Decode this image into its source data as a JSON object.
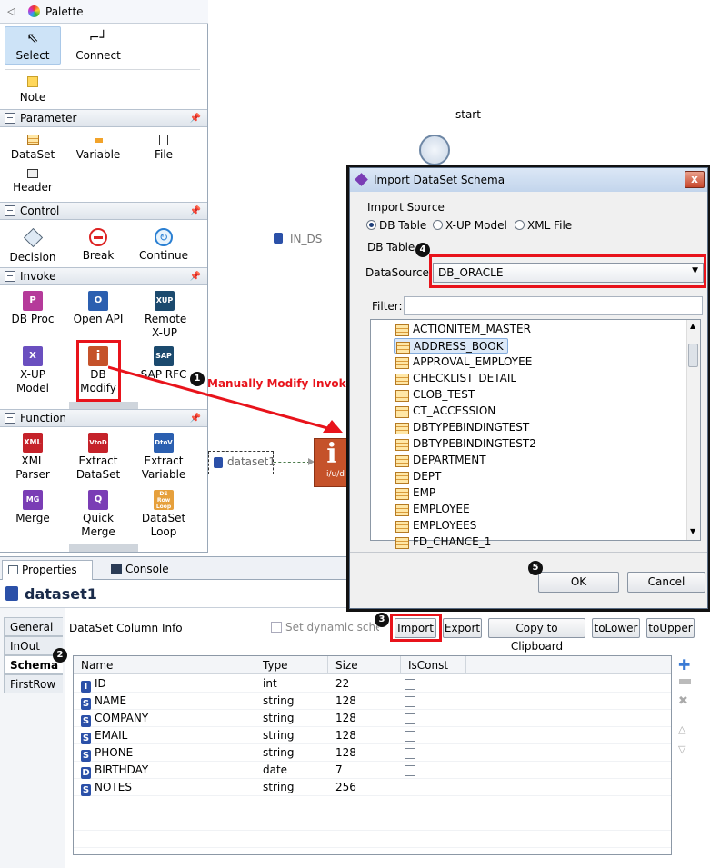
{
  "palette": {
    "title": "Palette",
    "tools": {
      "select": "Select",
      "connect": "Connect",
      "note": "Note"
    },
    "sections": [
      {
        "name": "Parameter",
        "items": [
          "DataSet",
          "Variable",
          "File",
          "Header"
        ]
      },
      {
        "name": "Control",
        "items": [
          "Decision",
          "Break",
          "Continue"
        ]
      },
      {
        "name": "Invoke",
        "items": [
          "DB Proc",
          "Open API",
          "Remote X-UP",
          "X-UP Model",
          "DB Modify",
          "SAP RFC"
        ]
      },
      {
        "name": "Function",
        "items": [
          "XML Parser",
          "Extract DataSet",
          "Extract Variable",
          "Merge",
          "Quick Merge",
          "DataSet Loop"
        ]
      }
    ],
    "icon_text": {
      "dbproc": "P",
      "openapi": "O",
      "xup": "XUP",
      "xupmodel": "X",
      "dbmodify": "i",
      "sap": "SAP",
      "xml": "XML",
      "vtod": "VtoD",
      "dtov": "DtoV",
      "mg": "MG",
      "q": "Q",
      "loop": "DS Row Loop"
    }
  },
  "canvas": {
    "start_label": "start",
    "in_ds_label": "IN_DS",
    "dataset_node": "dataset1",
    "modify_node_label": "i/u/d",
    "annotation": "Manually Modify Invoke"
  },
  "dialog": {
    "title": "Import DataSet Schema",
    "import_source_label": "Import Source",
    "radios": [
      "DB Table",
      "X-UP Model",
      "XML File"
    ],
    "db_table_label": "DB Table",
    "datasource_label": "DataSource:",
    "datasource_value": "DB_ORACLE",
    "filter_label": "Filter:",
    "tables": [
      "ACTIONITEM_MASTER",
      "ADDRESS_BOOK",
      "APPROVAL_EMPLOYEE",
      "CHECKLIST_DETAIL",
      "CLOB_TEST",
      "CT_ACCESSION",
      "DBTYPEBINDINGTEST",
      "DBTYPEBINDINGTEST2",
      "DEPARTMENT",
      "DEPT",
      "EMP",
      "EMPLOYEE",
      "EMPLOYEES",
      "FD_CHANCE_1"
    ],
    "selected_table": "ADDRESS_BOOK",
    "ok": "OK",
    "cancel": "Cancel",
    "close": "x"
  },
  "properties": {
    "tabs": [
      "Properties",
      "Console"
    ],
    "title": "dataset1",
    "left_tabs": [
      "General",
      "InOut",
      "Schema",
      "FirstRow"
    ],
    "column_info_label": "DataSet Column Info",
    "set_dynamic_label": "Set dynamic schema",
    "buttons": [
      "Import",
      "Export",
      "Copy to Clipboard",
      "toLower",
      "toUpper"
    ],
    "columns": [
      "Name",
      "Type",
      "Size",
      "IsConst"
    ],
    "rows": [
      {
        "icon": "I",
        "name": "ID",
        "type": "int",
        "size": "22"
      },
      {
        "icon": "S",
        "name": "NAME",
        "type": "string",
        "size": "128"
      },
      {
        "icon": "S",
        "name": "COMPANY",
        "type": "string",
        "size": "128"
      },
      {
        "icon": "S",
        "name": "EMAIL",
        "type": "string",
        "size": "128"
      },
      {
        "icon": "S",
        "name": "PHONE",
        "type": "string",
        "size": "128"
      },
      {
        "icon": "D",
        "name": "BIRTHDAY",
        "type": "date",
        "size": "7"
      },
      {
        "icon": "S",
        "name": "NOTES",
        "type": "string",
        "size": "256"
      }
    ]
  },
  "badges": [
    "1",
    "2",
    "3",
    "4",
    "5"
  ]
}
